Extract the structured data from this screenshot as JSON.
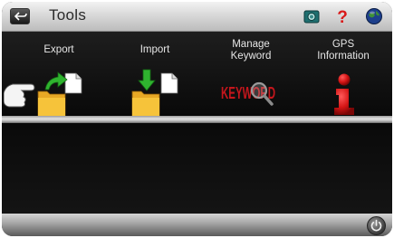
{
  "header": {
    "title": "Tools",
    "back_icon": "back-arrow-icon",
    "camera_icon": "camera-icon",
    "help_icon": "help-question-icon",
    "globe_icon": "globe-icon"
  },
  "tools": [
    {
      "label": "Export",
      "icon": "export-folder-icon"
    },
    {
      "label": "Import",
      "icon": "import-folder-icon"
    },
    {
      "label": "Manage\nKeyword",
      "icon": "keyword-magnifier-icon",
      "icon_text": "KEYWORD"
    },
    {
      "label": "GPS\nInformation",
      "icon": "info-icon",
      "icon_text": "i"
    }
  ],
  "footer": {
    "power_icon": "power-icon"
  },
  "colors": {
    "accent_green": "#2fb32f",
    "folder_yellow": "#f0b429",
    "keyword_red": "#c4161c"
  }
}
